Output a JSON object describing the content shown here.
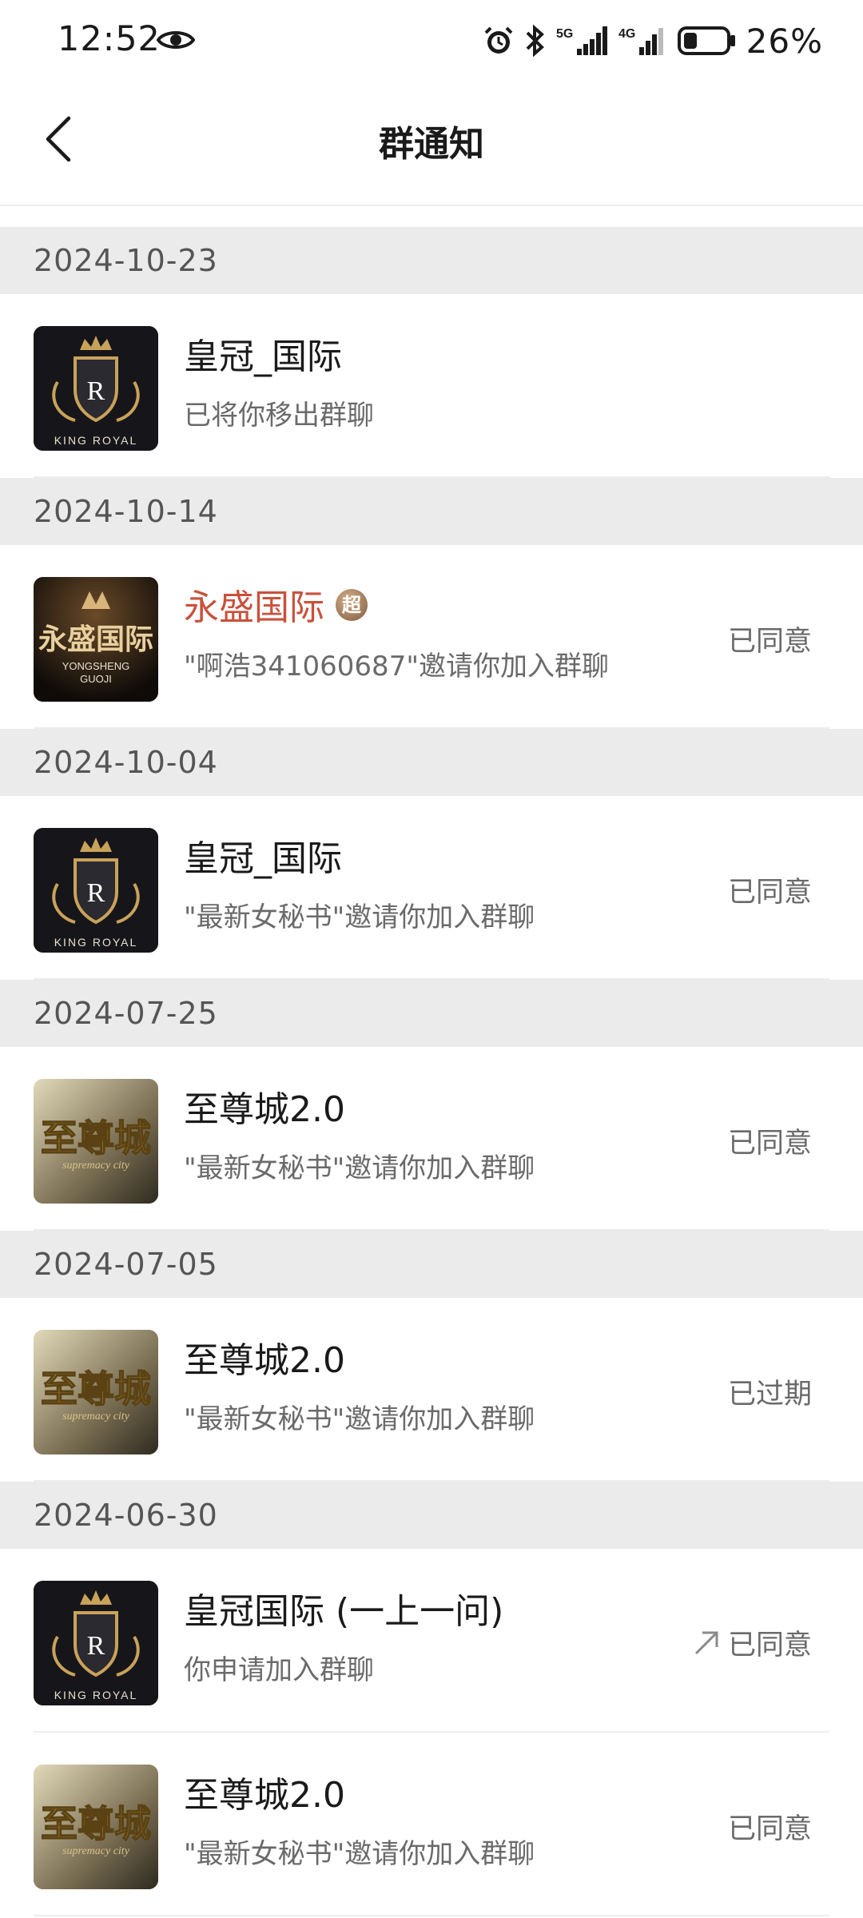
{
  "status_bar": {
    "time": "12:52",
    "battery_percent": "26%",
    "icons": [
      "eye-icon",
      "alarm-icon",
      "bluetooth-icon",
      "signal-5g-icon",
      "signal-4g-icon",
      "battery-icon"
    ]
  },
  "header": {
    "title": "群通知",
    "back_icon": "chevron-left-icon"
  },
  "groups": [
    {
      "date": "2024-10-23",
      "items": [
        {
          "avatar": "king-royal",
          "avatar_text": "KING ROYAL",
          "name": "皇冠_国际",
          "desc": "已将你移出群聊",
          "status": ""
        }
      ]
    },
    {
      "date": "2024-10-14",
      "items": [
        {
          "avatar": "yongsheng",
          "avatar_text": "永盛国际",
          "name": "永盛国际",
          "name_color": "#c9513c",
          "badge": "超",
          "desc": "\"啊浩341060687\"邀请你加入群聊",
          "status": "已同意"
        }
      ]
    },
    {
      "date": "2024-10-04",
      "items": [
        {
          "avatar": "king-royal",
          "avatar_text": "KING ROYAL",
          "name": "皇冠_国际",
          "desc": "\"最新女秘书\"邀请你加入群聊",
          "status": "已同意"
        }
      ]
    },
    {
      "date": "2024-07-25",
      "items": [
        {
          "avatar": "zhizuncheng",
          "avatar_text": "至尊城",
          "name": "至尊城2.0",
          "desc": "\"最新女秘书\"邀请你加入群聊",
          "status": "已同意"
        }
      ]
    },
    {
      "date": "2024-07-05",
      "items": [
        {
          "avatar": "zhizuncheng",
          "avatar_text": "至尊城",
          "name": "至尊城2.0",
          "desc": "\"最新女秘书\"邀请你加入群聊",
          "status": "已过期"
        }
      ]
    },
    {
      "date": "2024-06-30",
      "items": [
        {
          "avatar": "king-royal",
          "avatar_text": "KING ROYAL",
          "name": "皇冠国际 (一上一问)",
          "desc": "你申请加入群聊",
          "status": "已同意",
          "status_icon": "arrow-up-right-icon"
        },
        {
          "avatar": "zhizuncheng",
          "avatar_text": "至尊城",
          "name": "至尊城2.0",
          "desc": "\"最新女秘书\"邀请你加入群聊",
          "status": "已同意"
        }
      ]
    }
  ],
  "colors": {
    "accent_red": "#c9513c",
    "section_bg": "#ebebeb",
    "text_primary": "#1a1a1a",
    "text_secondary": "#6a6a6a"
  }
}
